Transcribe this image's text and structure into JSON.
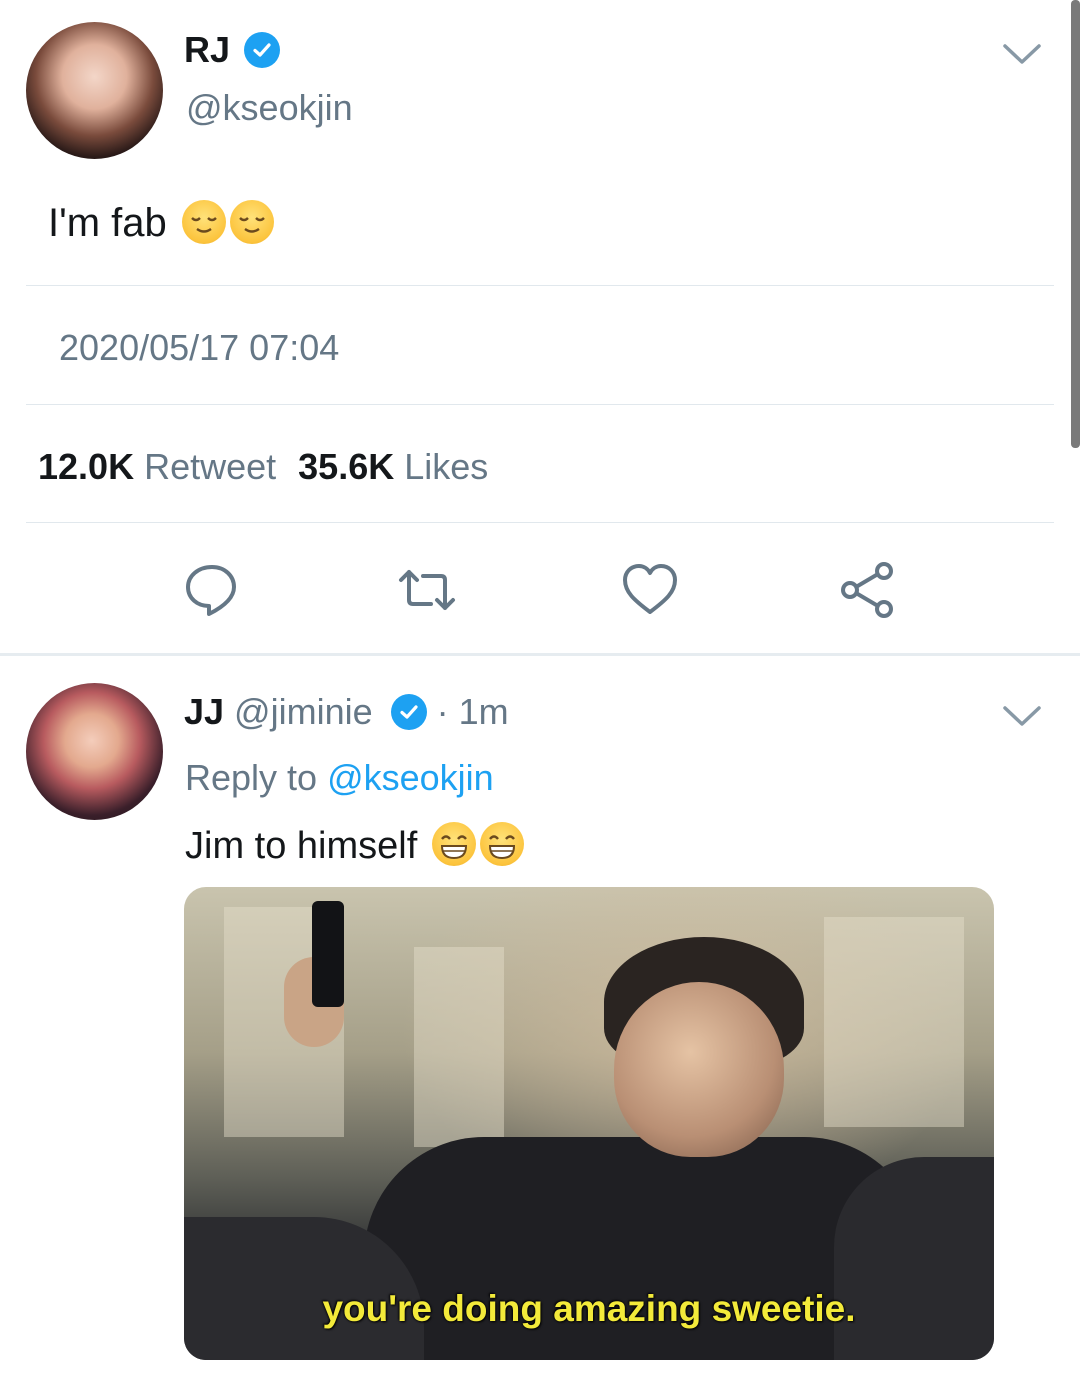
{
  "main_tweet": {
    "display_name": "RJ",
    "handle": "@kseokjin",
    "verified": true,
    "text": "I'm fab",
    "emojis": [
      "relieved-face-emoji",
      "relieved-face-emoji"
    ],
    "timestamp": "2020/05/17 07:04",
    "stats": {
      "retweets_count": "12.0K",
      "retweets_label": "Retweet",
      "likes_count": "35.6K",
      "likes_label": "Likes"
    },
    "actions": [
      "reply-icon",
      "retweet-icon",
      "like-icon",
      "share-icon"
    ]
  },
  "reply_tweet": {
    "display_name": "JJ",
    "handle": "@jiminie",
    "verified": true,
    "time_ago": "· 1m",
    "reply_to_prefix": "Reply to",
    "reply_to_handle": "@kseokjin",
    "text": "Jim to himself",
    "emojis": [
      "grinning-face-emoji",
      "grinning-face-emoji"
    ],
    "media_caption": "you're doing amazing sweetie."
  },
  "colors": {
    "accent": "#1da1f2",
    "secondary_text": "#657786",
    "divider": "#e1e8ed",
    "caption": "#f3ea3a"
  }
}
